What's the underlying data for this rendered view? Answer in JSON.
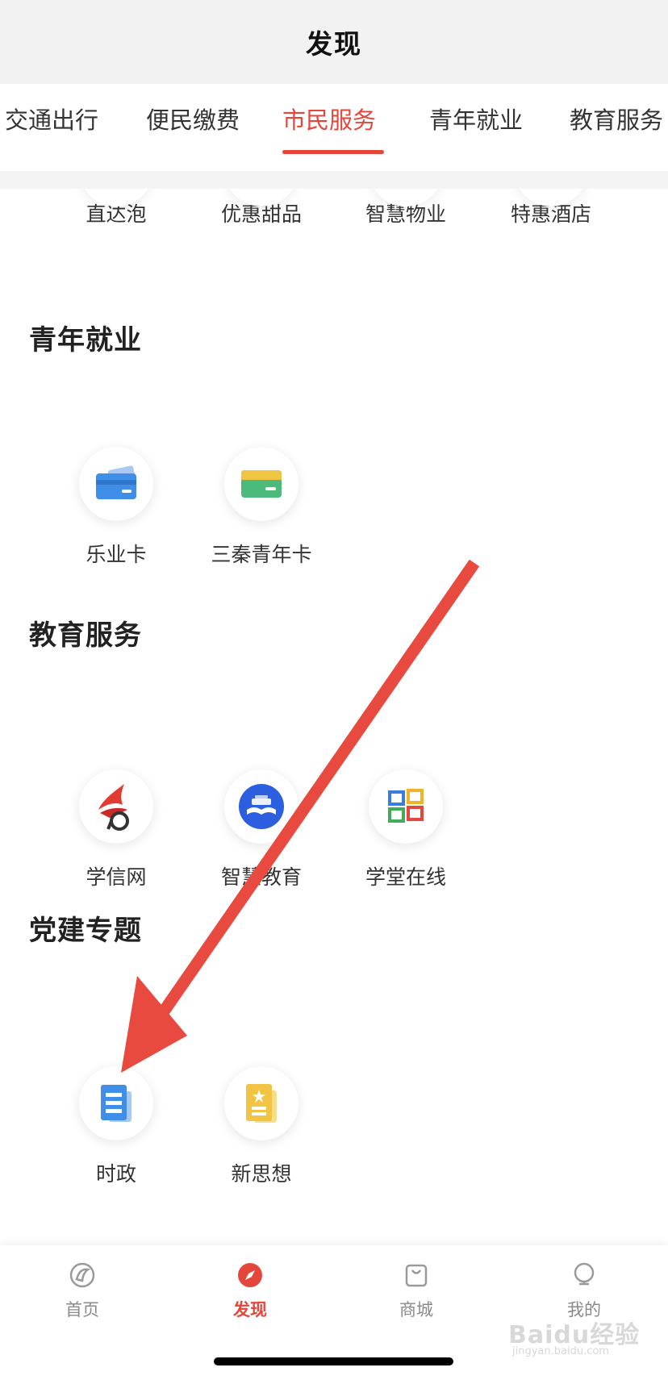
{
  "header": {
    "title": "发现"
  },
  "tabs": [
    {
      "label": "交通出行"
    },
    {
      "label": "便民缴费"
    },
    {
      "label": "市民服务",
      "active": true
    },
    {
      "label": "青年就业"
    },
    {
      "label": "教育服务"
    }
  ],
  "top_row": [
    {
      "label": "直达泡"
    },
    {
      "label": "优惠甜品"
    },
    {
      "label": "智慧物业"
    },
    {
      "label": "特惠酒店"
    }
  ],
  "sections": [
    {
      "title": "青年就业",
      "items": [
        {
          "label": "乐业卡",
          "icon": "blue-card-icon"
        },
        {
          "label": "三秦青年卡",
          "icon": "green-card-icon"
        }
      ]
    },
    {
      "title": "教育服务",
      "items": [
        {
          "label": "学信网",
          "icon": "xuexin-logo-icon"
        },
        {
          "label": "智慧教育",
          "icon": "open-book-icon"
        },
        {
          "label": "学堂在线",
          "icon": "grid-logo-icon"
        }
      ]
    },
    {
      "title": "党建专题",
      "items": [
        {
          "label": "时政",
          "icon": "document-icon"
        },
        {
          "label": "新思想",
          "icon": "star-document-icon"
        }
      ]
    }
  ],
  "bottom_nav": [
    {
      "label": "首页",
      "icon": "home-icon"
    },
    {
      "label": "发现",
      "icon": "compass-icon",
      "active": true
    },
    {
      "label": "商城",
      "icon": "shopping-bag-icon"
    },
    {
      "label": "我的",
      "icon": "profile-icon"
    }
  ],
  "watermark": {
    "text": "Baidu经验",
    "sub": "jingyan.baidu.com"
  },
  "colors": {
    "accent": "#e5463c",
    "annotation_arrow": "#e84a3f"
  }
}
